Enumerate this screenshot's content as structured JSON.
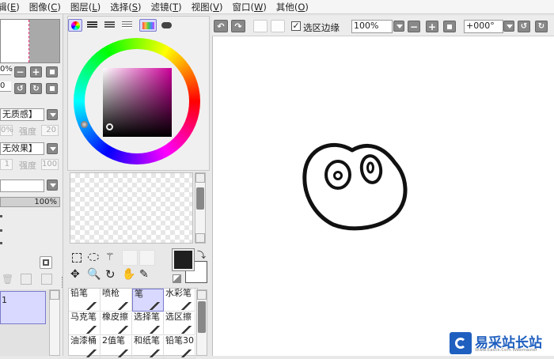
{
  "menu": [
    {
      "label": "辑(",
      "key": "E",
      "suffix": ")"
    },
    {
      "label": "图像(",
      "key": "C",
      "suffix": ")"
    },
    {
      "label": "图层(",
      "key": "L",
      "suffix": ")"
    },
    {
      "label": "选择(",
      "key": "S",
      "suffix": ")"
    },
    {
      "label": "滤镜(",
      "key": "T",
      "suffix": ")"
    },
    {
      "label": "视图(",
      "key": "V",
      "suffix": ")"
    },
    {
      "label": "窗口(",
      "key": "W",
      "suffix": ")"
    },
    {
      "label": "其他(",
      "key": "O",
      "suffix": ")"
    }
  ],
  "left_panel": {
    "zoom_partial": "0%",
    "angle_partial": "0",
    "texture_combo": "无质感】",
    "texture_value": "0%",
    "texture_strength_label": "强度",
    "texture_strength_value": "20",
    "effect_combo": "无效果】",
    "effect_value": "1",
    "effect_strength_label": "强度",
    "effect_strength_value": "100",
    "blend_combo": "",
    "opacity": "100%",
    "layer_name": "1"
  },
  "toolbar": {
    "selection_edge_label": "选区边缘",
    "selection_edge_checked": true,
    "zoom_value": "100%",
    "rotation_value": "+000°"
  },
  "brushes": [
    {
      "label": "铅笔",
      "icon": "pencil-icon",
      "selected": false
    },
    {
      "label": "喷枪",
      "icon": "airbrush-icon",
      "selected": false
    },
    {
      "label": "笔",
      "icon": "pen-icon",
      "selected": true
    },
    {
      "label": "水彩笔",
      "icon": "watercolor-icon",
      "selected": false
    },
    {
      "label": "马克笔",
      "icon": "marker-icon",
      "selected": false
    },
    {
      "label": "橡皮擦",
      "icon": "eraser-icon",
      "selected": false
    },
    {
      "label": "选择笔",
      "icon": "select-pen-icon",
      "selected": false
    },
    {
      "label": "选区擦",
      "icon": "select-eraser-icon",
      "selected": false
    },
    {
      "label": "油漆桶",
      "icon": "bucket-icon",
      "selected": false
    },
    {
      "label": "2值笔",
      "icon": "binary-pen-icon",
      "selected": false
    },
    {
      "label": "和纸笔",
      "icon": "washi-pen-icon",
      "selected": false
    },
    {
      "label": "铅笔30",
      "icon": "pencil30-icon",
      "selected": false
    }
  ],
  "colors": {
    "foreground": "#1f1f1f",
    "background": "#ffffff",
    "accent_select": "#d9d9ff"
  },
  "watermark": {
    "title": "易采站长站",
    "subtitle": "Www.Easck.Com Webmaster"
  }
}
